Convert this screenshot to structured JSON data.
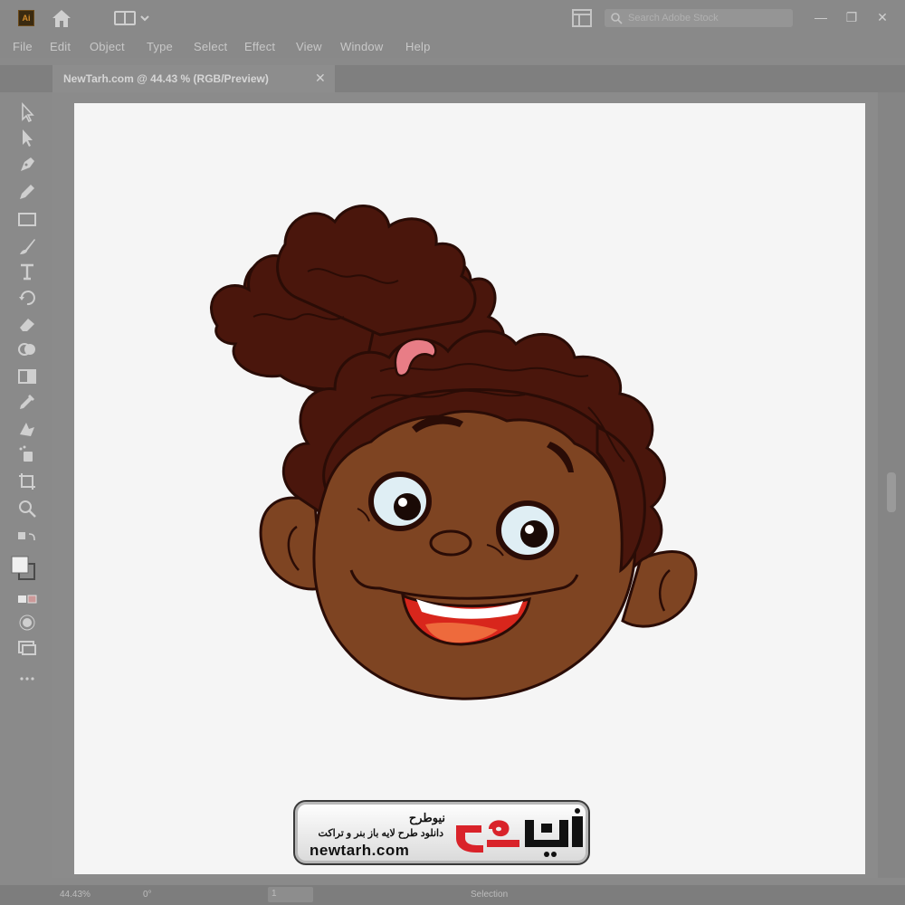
{
  "window": {
    "app_logo": "Ai",
    "search_placeholder": "Search Adobe Stock",
    "controls": [
      "—",
      "❐",
      "✕"
    ]
  },
  "menu": [
    "File",
    "Edit",
    "Object",
    "Type",
    "Select",
    "Effect",
    "View",
    "Window",
    "Help"
  ],
  "document_tab": {
    "title": "NewTarh.com @ 44.43 % (RGB/Preview)",
    "close": "✕"
  },
  "tools": [
    "selection-tool",
    "direct-selection-tool",
    "pen-tool",
    "pencil-tool",
    "rectangle-tool",
    "paintbrush-tool",
    "type-tool",
    "rotate-tool",
    "eraser-tool",
    "shape-builder-tool",
    "gradient-tool",
    "eyedropper-tool",
    "blend-tool",
    "symbol-sprayer-tool",
    "artboard-tool",
    "zoom-tool",
    "fill-stroke-swap",
    "fill-stroke-swatches",
    "color-mode",
    "draw-mode",
    "screen-mode",
    "more-tools"
  ],
  "status": {
    "zoom": "44.43%",
    "rotation": "0°",
    "artboard": "1",
    "mode": "Selection"
  },
  "watermark": {
    "fa_title": "نیوطرح",
    "fa_subtitle": "دانلود طرح لایه باز بنر و تراکت",
    "url": "newtarh.com",
    "logo_text": "نیوطرح"
  },
  "colors": {
    "skin": "#7e4422",
    "hair": "#4a160c",
    "outline": "#2a0c06",
    "hair_tie": "#e87d86",
    "eye_white": "#dfeef4",
    "mouth": "#d8261c",
    "tongue": "#ee6a3c",
    "logo_red": "#d9232a"
  }
}
